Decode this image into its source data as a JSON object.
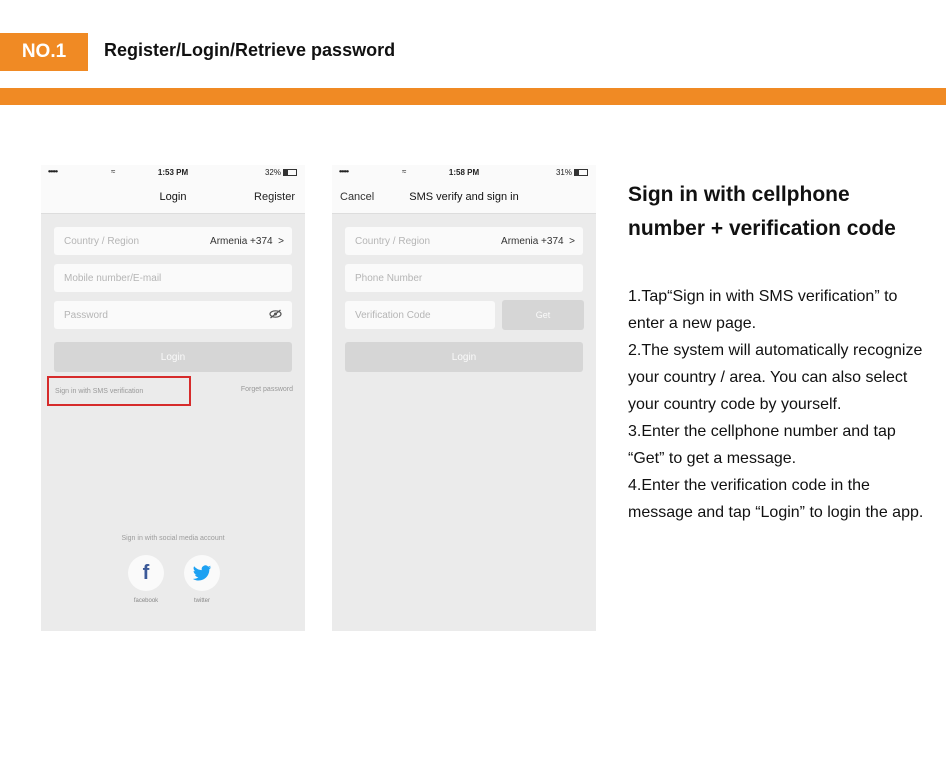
{
  "header": {
    "badge": "NO.1",
    "title": "Register/Login/Retrieve password",
    "accent_color": "#f08a24"
  },
  "phone1": {
    "status": {
      "signal": "•••••",
      "wifi": "wifi-icon",
      "time": "1:53 PM",
      "battery": "32%"
    },
    "nav": {
      "title": "Login",
      "right": "Register"
    },
    "country": {
      "label": "Country / Region",
      "value": "Armenia +374",
      "chevron": ">"
    },
    "mobile_placeholder": "Mobile number/E-mail",
    "password_placeholder": "Password",
    "login_button": "Login",
    "sms_link": "Sign in with SMS verification",
    "forgot_link": "Forget password",
    "social_label": "Sign in with social media account",
    "facebook_label": "facebook",
    "twitter_label": "twitter",
    "highlight_color": "#d62b2b"
  },
  "phone2": {
    "status": {
      "signal": "•••••",
      "wifi": "wifi-icon",
      "time": "1:58 PM",
      "battery": "31%"
    },
    "nav": {
      "left": "Cancel",
      "title": "SMS verify and sign in"
    },
    "country": {
      "label": "Country / Region",
      "value": "Armenia +374",
      "chevron": ">"
    },
    "phone_placeholder": "Phone Number",
    "code_placeholder": "Verification Code",
    "get_button": "Get",
    "login_button": "Login"
  },
  "description": {
    "title": "Sign in with cellphone number + verification code",
    "steps": [
      "1.Tap“Sign in with SMS verification” to enter a new page.",
      "2.The system will automatically recognize your country / area. You can also select your country code by yourself.",
      "3.Enter the cellphone number and tap “Get” to get a message.",
      "4.Enter the verification code in the message and tap “Login” to login the app."
    ]
  }
}
